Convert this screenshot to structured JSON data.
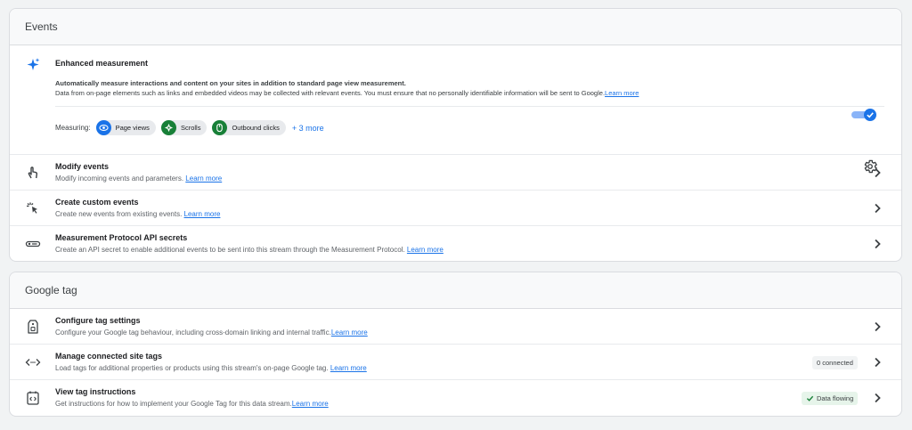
{
  "events": {
    "title": "Events",
    "enhanced": {
      "title": "Enhanced measurement",
      "desc1": "Automatically measure interactions and content on your sites in addition to standard page view measurement.",
      "desc2": "Data from on-page elements such as links and embedded videos may be collected with relevant events. You must ensure that no personally identifiable information will be sent to Google.",
      "learn_more": "Learn more",
      "enabled": true,
      "measuring_label": "Measuring:",
      "chips": [
        {
          "label": "Page views",
          "icon": "eye-icon",
          "color": "#1a73e8"
        },
        {
          "label": "Scrolls",
          "icon": "compass-icon",
          "color": "#188038"
        },
        {
          "label": "Outbound clicks",
          "icon": "mouse-icon",
          "color": "#188038"
        }
      ],
      "more": "+ 3 more"
    },
    "rows": [
      {
        "title": "Modify events",
        "desc": "Modify incoming events and parameters. ",
        "link": "Learn more",
        "icon": "touch-icon"
      },
      {
        "title": "Create custom events",
        "desc": "Create new events from existing events. ",
        "link": "Learn more",
        "icon": "sparkle-click-icon"
      },
      {
        "title": "Measurement Protocol API secrets",
        "desc": "Create an API secret to enable additional events to be sent into this stream through the Measurement Protocol. ",
        "link": "Learn more",
        "icon": "key-icon"
      }
    ]
  },
  "google_tag": {
    "title": "Google tag",
    "rows": [
      {
        "title": "Configure tag settings",
        "desc": "Configure your Google tag behaviour, including cross-domain linking and internal traffic.",
        "link": "Learn more",
        "icon": "tag-icon"
      },
      {
        "title": "Manage connected site tags",
        "desc": "Load tags for additional properties or products using this stream's on-page Google tag. ",
        "link": "Learn more",
        "icon": "code-icon",
        "badge": "0 connected"
      },
      {
        "title": "View tag instructions",
        "desc": "Get instructions for how to implement your Google Tag for this data stream.",
        "link": "Learn more",
        "icon": "code-doc-icon",
        "badge": "Data flowing"
      }
    ]
  },
  "colors": {
    "accent": "#1a73e8",
    "success": "#188038",
    "success_bg": "#e6f4ea"
  }
}
